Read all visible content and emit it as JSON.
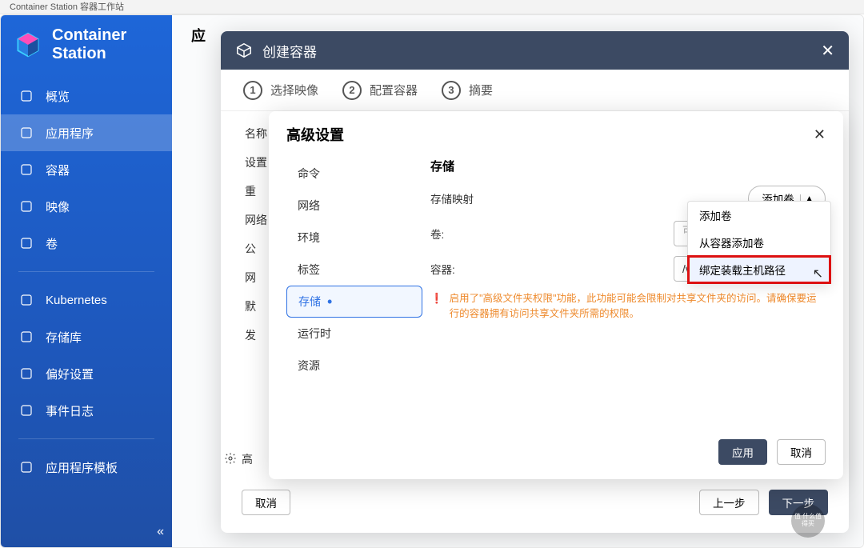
{
  "window_title": "Container Station 容器工作站",
  "brand": "Container Station",
  "sidebar": {
    "items": [
      {
        "label": "概览",
        "icon": "gauge-icon"
      },
      {
        "label": "应用程序",
        "icon": "grid-icon",
        "active": true
      },
      {
        "label": "容器",
        "icon": "cube-icon"
      },
      {
        "label": "映像",
        "icon": "layers-icon"
      },
      {
        "label": "卷",
        "icon": "database-icon"
      }
    ],
    "items2": [
      {
        "label": "Kubernetes",
        "icon": "wheel-icon"
      },
      {
        "label": "存储库",
        "icon": "tiles-icon"
      },
      {
        "label": "偏好设置",
        "icon": "gear-icon"
      },
      {
        "label": "事件日志",
        "icon": "list-icon"
      }
    ],
    "items3": [
      {
        "label": "应用程序模板",
        "icon": "template-icon"
      }
    ]
  },
  "main_header": "应",
  "modal": {
    "title": "创建容器",
    "steps": [
      "选择映像",
      "配置容器",
      "摘要"
    ],
    "bg_labels": [
      "名称",
      "设置",
      "重",
      "网络",
      "公",
      "网",
      "默",
      "发"
    ],
    "gear_label": "高",
    "footer": {
      "cancel": "取消",
      "prev": "上一步",
      "next": "下一步"
    }
  },
  "adv": {
    "title": "高级设置",
    "tabs": [
      "命令",
      "网络",
      "环境",
      "标签",
      "存储",
      "运行时",
      "资源"
    ],
    "active_tab": 4,
    "storage": {
      "section": "存储",
      "mapping_label": "存储映射",
      "add_btn": "添加卷",
      "rows": {
        "volume_label": "卷:",
        "volume_value": "可选",
        "container_label": "容器:",
        "container_value": "/var/www/html"
      },
      "warning": "启用了\"高级文件夹权限\"功能，此功能可能会限制对共享文件夹的访问。请确保要运行的容器拥有访问共享文件夹所需的权限。"
    },
    "footer": {
      "apply": "应用",
      "cancel": "取消"
    }
  },
  "dropdown": {
    "items": [
      "添加卷",
      "从容器添加卷",
      "绑定装载主机路径"
    ],
    "highlight": 2
  },
  "watermark": "值 什么值得买"
}
